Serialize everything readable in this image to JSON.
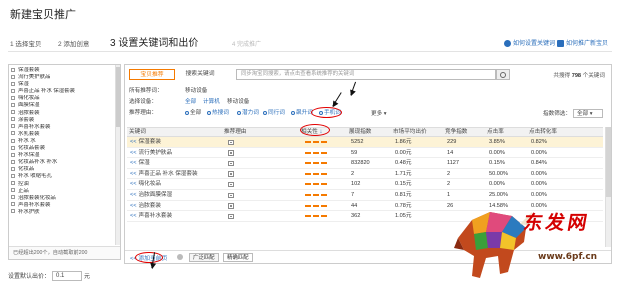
{
  "page": {
    "title": "新建宝贝推广"
  },
  "steps": [
    {
      "label": "1 选择宝贝"
    },
    {
      "label": "2 添加创意"
    },
    {
      "label": "3 设置关键词和出价"
    },
    {
      "label": "4 完成推广"
    }
  ],
  "help_links": {
    "how_set_keywords": "如何设置关键词",
    "how_promote": "如何推广新宝贝"
  },
  "left_panel": {
    "items": [
      "保湿套装",
      "流行美护肤品",
      "保湿",
      "声喜正品 补水 保湿套装",
      "嗨化妆品",
      "面膜保湿",
      "治脓套装",
      "涂套装",
      "声喜补水套装",
      "水乳套装",
      "补水 水",
      "化妆品套装",
      "补水保湿",
      "化妆品补水 补水",
      "化妆品",
      "补水 收缩毛孔",
      "控油",
      "正品",
      "治脓套装化妆品",
      "声喜补水套装",
      "补水护肤"
    ],
    "footer": "已经超出200个，自动截取前200"
  },
  "bid": {
    "label": "设置默认出价：",
    "value": "0.1",
    "unit": "元"
  },
  "right_panel": {
    "tabs": [
      {
        "label": "宝贝推荐",
        "active": true
      },
      {
        "label": "搜索关键词",
        "active": false
      }
    ],
    "search_placeholder": "同步淘宝同搜索，请点击查看系统推荐的关键词",
    "total_prefix": "共搜得",
    "total_count": "798",
    "total_suffix": "个关键词",
    "filters": {
      "all_recommend_label": "所有推荐词：",
      "all_recommend_value": "移动设备",
      "device_label": "选择设备：",
      "device_options": [
        "全部",
        "计算机",
        "移动设备"
      ],
      "reason_label": "推荐理由：",
      "reason_options": [
        "全部",
        "热搜词",
        "潜力词",
        "同行词",
        "飙升词",
        "手机词"
      ],
      "more": "更多",
      "index_filter_label": "指数筛选：",
      "index_filter_value": "全部"
    },
    "columns": [
      "关键词",
      "推荐理由",
      "相关性",
      "展现指数",
      "市场平均出价",
      "竞争指数",
      "点击率",
      "点击转化率"
    ],
    "rows": [
      {
        "add": "<<",
        "keyword": "保湿套装",
        "impressions": "5252",
        "avg_bid": "1.86元",
        "competition": "229",
        "ctr": "3.85%",
        "cvr": "0.82%",
        "highlight": true
      },
      {
        "add": "<<",
        "keyword": "流行美护肤品",
        "impressions": "59",
        "avg_bid": "0.00元",
        "competition": "14",
        "ctr": "0.00%",
        "cvr": "0.00%",
        "highlight": false
      },
      {
        "add": "<<",
        "keyword": "保湿",
        "impressions": "832820",
        "avg_bid": "0.48元",
        "competition": "1127",
        "ctr": "0.15%",
        "cvr": "0.84%",
        "highlight": false
      },
      {
        "add": "<<",
        "keyword": "声喜正品 补水 保湿套装",
        "impressions": "2",
        "avg_bid": "1.71元",
        "competition": "2",
        "ctr": "50.00%",
        "cvr": "0.00%",
        "highlight": false
      },
      {
        "add": "<<",
        "keyword": "嗨化妆品",
        "impressions": "102",
        "avg_bid": "0.15元",
        "competition": "2",
        "ctr": "0.00%",
        "cvr": "0.00%",
        "highlight": false
      },
      {
        "add": "<<",
        "keyword": "治脓面膜保湿",
        "impressions": "7",
        "avg_bid": "0.81元",
        "competition": "1",
        "ctr": "25.00%",
        "cvr": "0.00%",
        "highlight": false
      },
      {
        "add": "<<",
        "keyword": "治脓套装",
        "impressions": "44",
        "avg_bid": "0.78元",
        "competition": "26",
        "ctr": "14.58%",
        "cvr": "0.00%",
        "highlight": false
      },
      {
        "add": "<<",
        "keyword": "声喜补水套装",
        "impressions": "362",
        "avg_bid": "1.05元",
        "competition": "",
        "ctr": "",
        "cvr": "",
        "highlight": false
      }
    ],
    "bottom": {
      "add_page": "<< 添加当前页",
      "broad_match": "广泛匹配",
      "exact_match": "精确匹配"
    }
  },
  "watermark": {
    "brand": "东发网",
    "url": "www.6pf.cn"
  },
  "colors": {
    "accent": "#f57a00",
    "link": "#2a6ebb",
    "annotation": "#e20000",
    "row_highlight": "#fdf3d6"
  }
}
